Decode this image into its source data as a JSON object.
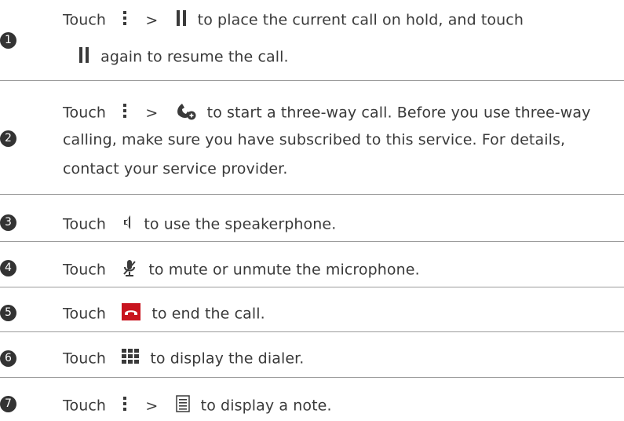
{
  "steps": [
    {
      "number": "1",
      "lines": [
        {
          "prefix": "Touch",
          "sep": ">",
          "text": "to place the current call on hold, and touch"
        },
        {
          "text": "again to resume the call."
        }
      ]
    },
    {
      "number": "2",
      "lines": [
        {
          "prefix": "Touch",
          "sep": ">",
          "text": "to start a three-way call. Before you use three-way"
        },
        {
          "text": "calling, make sure you have subscribed to this service. For details,"
        },
        {
          "text": "contact your service provider."
        }
      ]
    },
    {
      "number": "3",
      "prefix": "Touch",
      "text": "to use the speakerphone."
    },
    {
      "number": "4",
      "prefix": "Touch",
      "text": "to mute or unmute the microphone."
    },
    {
      "number": "5",
      "prefix": "Touch",
      "text": "to end the call."
    },
    {
      "number": "6",
      "prefix": "Touch",
      "text": "to display the dialer."
    },
    {
      "number": "7",
      "prefix": "Touch",
      "sep": ">",
      "text": "to display a note."
    }
  ],
  "icons": {
    "menu": "more-vertical-icon",
    "hold": "pause-icon",
    "add_call": "add-call-icon",
    "speaker": "speaker-icon",
    "mute": "microphone-mute-icon",
    "end_call": "end-call-icon",
    "dialpad": "dialpad-icon",
    "note": "note-icon"
  },
  "colors": {
    "text": "#3a3a3a",
    "badge": "#333333",
    "divider": "#9c9c9c",
    "end_call": "#c8141e"
  }
}
